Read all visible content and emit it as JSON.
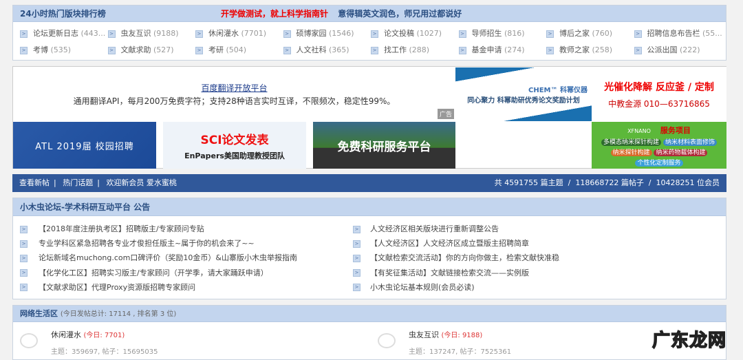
{
  "rank": {
    "title": "24小时热门版块排行榜",
    "promo_red": "开学做测试，就上科学指南针",
    "promo_blue": "意得辑英文润色，师兄用过都说好",
    "items": [
      [
        "论坛更新日志",
        "(443..."
      ],
      [
        "虫友互识",
        "(9188)"
      ],
      [
        "休闲灌水",
        "(7701)"
      ],
      [
        "硕博家园",
        "(1546)"
      ],
      [
        "论文投稿",
        "(1027)"
      ],
      [
        "导师招生",
        "(816)"
      ],
      [
        "博后之家",
        "(760)"
      ],
      [
        "招聘信息布告栏",
        "(55..."
      ],
      [
        "考博",
        "(535)"
      ],
      [
        "文献求助",
        "(527)"
      ],
      [
        "考研",
        "(504)"
      ],
      [
        "人文社科",
        "(365)"
      ],
      [
        "找工作",
        "(288)"
      ],
      [
        "基金申请",
        "(274)"
      ],
      [
        "教师之家",
        "(258)"
      ],
      [
        "公派出国",
        "(222)"
      ]
    ]
  },
  "ads": {
    "text_title": "百度翻译开放平台",
    "text_desc": "通用翻译API，每月200万免费字符；支持28种语言实时互译，不限频次，稳定性99%。",
    "ad_label": "广告",
    "chem_brand": "CHEM™ 科幂仪器",
    "chem_text": "同心聚力 科幂助研优秀论文奖励计划",
    "red_line1": "光催化降解  反应釜 / 定制",
    "red_line2": "中教金源  010—63716865",
    "atl": "ATL 2019届 校园招聘",
    "sci_title": "SCI论文发表",
    "sci_sub": "EnPapers美国助理教授团队",
    "free": "免费科研服务平台",
    "nano_brand": "XFNANO",
    "nano_title": "服务项目",
    "nano_items": [
      "多模态纳米探针构建",
      "纳米材料表面修饰",
      "纳米探针构建",
      "纳米药物载体构建",
      "个性化定制服务"
    ]
  },
  "nav": {
    "new_posts": "查看新帖",
    "hot": "热门话题",
    "welcome": "欢迎新会员 爱水蜜桃",
    "stats": "共 4591755 篇主题  /  118668722 篇帖子  /  10428251 位会员"
  },
  "announce": {
    "title": "小木虫论坛-学术科研互动平台 公告",
    "left": [
      "【2018年度注册执考区】招聘版主/专家顾问专贴",
      "专业学科区紧急招聘各专业才俊担任版主~属于你的机会来了~~",
      "论坛新域名muchong.com口碑评价（奖励10金币）&山寨版小木虫举报指南",
      "【化学化工区】招聘实习版主/专家顾问（开学季，请大家踊跃申请）",
      "【文献求助区】代理Proxy资源版招聘专家顾问"
    ],
    "right": [
      "人文经济区相关版块进行重新调整公告",
      "【人文经济区】人文经济区成立暨版主招聘简章",
      "【文献检索交流活动】你的方向你做主，检索文献快准稳",
      "【有奖征集活动】文献链接检索交流——实例版",
      "小木虫论坛基本规则(会员必读)"
    ]
  },
  "life": {
    "title": "网络生活区",
    "meta": "(今日发帖总计: 17114 , 排名第 3 位)",
    "forums": [
      {
        "name": "休闲灌水",
        "today": "(今日: 7701)",
        "stats": "主题：359697, 帖子：15695035"
      },
      {
        "name": "虫友互识",
        "today": "(今日: 9188)",
        "stats": "主题：137247, 帖子：7525361"
      }
    ]
  },
  "watermark": "广东龙网"
}
